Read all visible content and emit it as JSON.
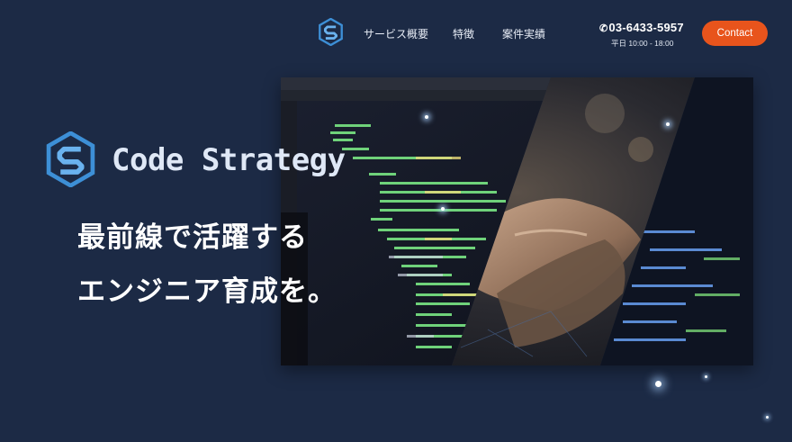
{
  "nav": {
    "links": [
      "サービス概要",
      "特徴",
      "案件実績"
    ],
    "phone": "03-6433-5957",
    "hours": "平日 10:00 - 18:00",
    "contact_label": "Contact"
  },
  "hero": {
    "brand_name": "Code Strategy",
    "headline_line1": "最前線で活躍する",
    "headline_line2": "エンジニア育成を。"
  },
  "colors": {
    "background": "#1c2a45",
    "accent": "#e8541c",
    "logo_blue": "#3d8fd6"
  },
  "icons": [
    "code-strategy-logo-icon",
    "phone-icon"
  ]
}
